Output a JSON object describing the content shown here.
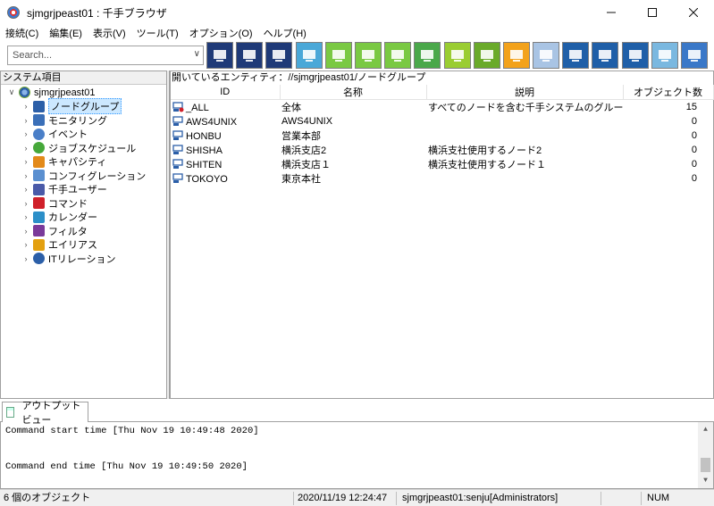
{
  "window": {
    "title": "sjmgrjpeast01 : 千手ブラウザ"
  },
  "menu": [
    "接続(C)",
    "編集(E)",
    "表示(V)",
    "ツール(T)",
    "オプション(O)",
    "ヘルプ(H)"
  ],
  "search": {
    "placeholder": "Search...",
    "value": ""
  },
  "toolbar_icons": [
    "node-map-icon",
    "monitor-icon",
    "monitor-settings-icon",
    "message-icon",
    "puzzle-icon",
    "puzzle-check-icon",
    "puzzle-add-icon",
    "display-check-icon",
    "chart-doc-icon",
    "list-doc-icon",
    "bar-chart-icon",
    "grid-icon",
    "window-arrow-icon",
    "window-check-icon",
    "window-export-icon",
    "log-icon",
    "radar-icon"
  ],
  "tree": {
    "header": "システム項目",
    "root": "sjmgrjpeast01",
    "items": [
      {
        "label": "ノードグループ",
        "icon": "node-group-icon",
        "selected": true
      },
      {
        "label": "モニタリング",
        "icon": "monitoring-icon"
      },
      {
        "label": "イベント",
        "icon": "event-icon"
      },
      {
        "label": "ジョブスケジュール",
        "icon": "job-schedule-icon"
      },
      {
        "label": "キャパシティ",
        "icon": "capacity-icon"
      },
      {
        "label": "コンフィグレーション",
        "icon": "configuration-icon"
      },
      {
        "label": "千手ユーザー",
        "icon": "user-icon"
      },
      {
        "label": "コマンド",
        "icon": "command-icon"
      },
      {
        "label": "カレンダー",
        "icon": "calendar-icon"
      },
      {
        "label": "フィルタ",
        "icon": "filter-icon"
      },
      {
        "label": "エイリアス",
        "icon": "alias-icon"
      },
      {
        "label": "ITリレーション",
        "icon": "it-relation-icon"
      }
    ]
  },
  "main": {
    "path": "開いているエンティティ：//sjmgrjpeast01/ノードグループ",
    "columns": [
      "ID",
      "名称",
      "説明",
      "オブジェクト数"
    ],
    "rows": [
      {
        "id": "_ALL",
        "name": "全体",
        "desc": "すべてのノードを含む千手システムのグループ",
        "count": "15"
      },
      {
        "id": "AWS4UNIX",
        "name": "AWS4UNIX",
        "desc": "",
        "count": "0"
      },
      {
        "id": "HONBU",
        "name": "営業本部",
        "desc": "",
        "count": "0"
      },
      {
        "id": "SHISHA",
        "name": "横浜支店2",
        "desc": "横浜支社使用するノード2",
        "count": "0"
      },
      {
        "id": "SHITEN",
        "name": "横浜支店１",
        "desc": "横浜支社使用するノード１",
        "count": "0"
      },
      {
        "id": "TOKOYO",
        "name": "東京本社",
        "desc": "",
        "count": "0"
      }
    ]
  },
  "output": {
    "tab_label": "アウトプットビュー",
    "lines": [
      "Command start time [Thu Nov 19 10:49:48 2020]",
      "Command end time [Thu Nov 19 10:49:50 2020]"
    ]
  },
  "status": {
    "count": "6 個のオブジェクト",
    "datetime": "2020/11/19 12:24:47",
    "user": "sjmgrjpeast01:senju[Administrators]",
    "num": "NUM"
  }
}
